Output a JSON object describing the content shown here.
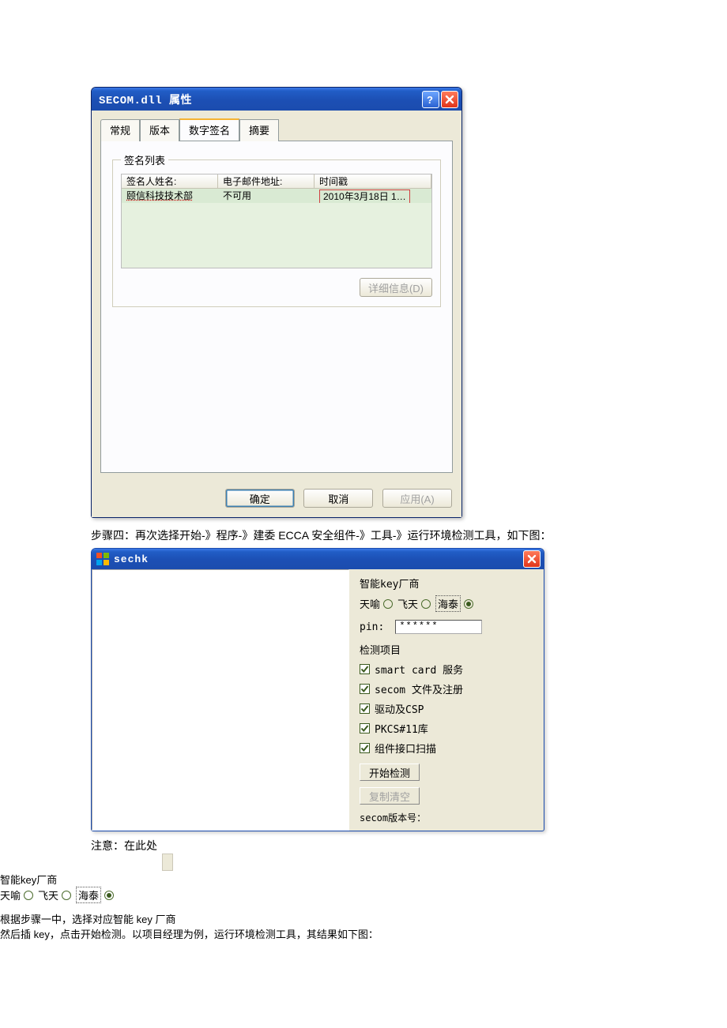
{
  "dlg1": {
    "title": "SECOM.dll 属性",
    "tabs": [
      "常规",
      "版本",
      "数字签名",
      "摘要"
    ],
    "active_tab": 2,
    "siglist_legend": "签名列表",
    "columns": [
      "签名人姓名:",
      "电子邮件地址:",
      "时间戳"
    ],
    "row": {
      "name": "颐信科技技术部",
      "email": "不可用",
      "time": "2010年3月18日 1…"
    },
    "details_btn": "详细信息(D)",
    "ok": "确定",
    "cancel": "取消",
    "apply": "应用(A)"
  },
  "para_step4": "步骤四：再次选择开始-》程序-》建委 ECCA 安全组件-》工具-》运行环境检测工具，如下图：",
  "dlg2": {
    "title": "sechk",
    "vendor_heading": "智能key厂商",
    "vendor_options": [
      {
        "label": "天喻",
        "checked": false
      },
      {
        "label": "飞天",
        "checked": false
      },
      {
        "label": "海泰",
        "checked": true,
        "boxed": true
      }
    ],
    "pin_label": "pin:",
    "pin_value": "******",
    "check_heading": "检测项目",
    "checks": [
      {
        "label": "smart card 服务",
        "checked": true
      },
      {
        "label": "secom 文件及注册",
        "checked": true
      },
      {
        "label": "驱动及CSP",
        "checked": true
      },
      {
        "label": "PKCS#11库",
        "checked": true
      },
      {
        "label": "组件接口扫描",
        "checked": true
      }
    ],
    "start_btn": "开始检测",
    "clear_btn": "复制清空",
    "version_label": "secom版本号："
  },
  "note": {
    "prefix": "注意：在此处",
    "mid": "根据步骤一中，选择对应智能 key 厂商",
    "line2": "然后插 key，点击开始检测。以项目经理为例，运行环境检测工具，其结果如下图："
  }
}
